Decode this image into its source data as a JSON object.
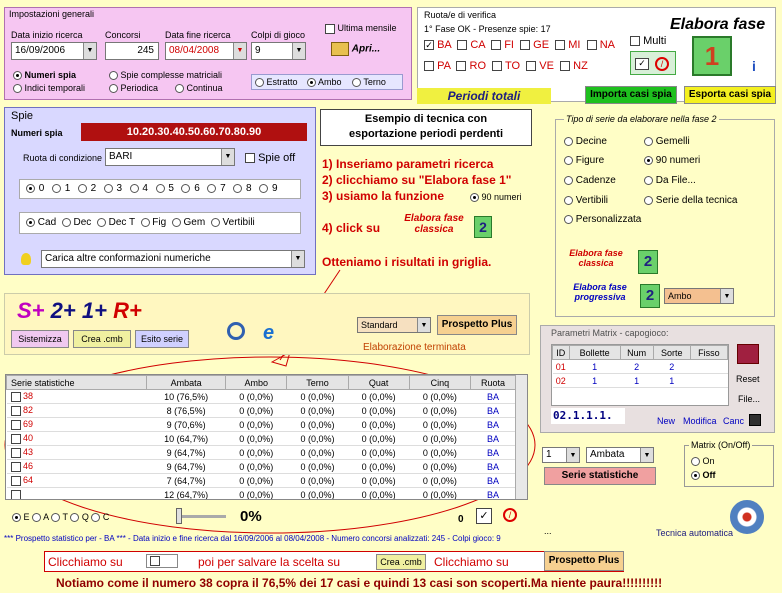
{
  "general": {
    "title": "Impostazioni generali",
    "concorsi_label": "Concorsi",
    "data_inizio_label": "Data inizio ricerca",
    "data_fine_label": "Data fine ricerca",
    "colpi_label": "Colpi di gioco",
    "data_inizio": "16/09/2006",
    "concorsi": "245",
    "data_fine": "08/04/2008",
    "colpi": "9",
    "ultima_mensile": "Ultima mensile",
    "apri": "Apri...",
    "opt_numeri_spia": "Numeri spia",
    "opt_indici": "Indici temporali",
    "opt_spie_complesse": "Spie complesse matriciali",
    "opt_periodica": "Periodica",
    "opt_continua": "Continua",
    "opt_estratto": "Estratto",
    "opt_ambo": "Ambo",
    "opt_terno": "Terno"
  },
  "ruota": {
    "title": "Ruota/e di verifica",
    "status": "1° Fase OK - Presenze spie: 17",
    "row1": [
      "BA",
      "CA",
      "FI",
      "GE",
      "MI",
      "NA"
    ],
    "row2": [
      "PA",
      "RO",
      "TO",
      "VE",
      "NZ"
    ],
    "multi": "Multi"
  },
  "elabora": {
    "title": "Elabora fase",
    "badge": "1"
  },
  "periodi_totali": "Periodi totali",
  "importa": "Importa casi spia",
  "esporta": "Esporta casi spia",
  "spie": {
    "title": "Spie",
    "numeri_label": "Numeri spia",
    "numeri_value": "10.20.30.40.50.60.70.80.90",
    "ruota_label": "Ruota di condizione",
    "ruota_value": "BARI",
    "spie_off": "Spie off",
    "digits": [
      "0",
      "1",
      "2",
      "3",
      "4",
      "5",
      "6",
      "7",
      "8",
      "9"
    ],
    "types": [
      "Cad",
      "Dec",
      "Dec T",
      "Fig",
      "Gem",
      "Vertibili"
    ],
    "carica": "Carica altre conformazioni numeriche"
  },
  "tutorial": {
    "title_line1": "Esempio di tecnica con",
    "title_line2": "esportazione periodi perdenti",
    "step1": "1) Inseriamo parametri ricerca",
    "step2": "2) clicchiamo su \"Elabora fase 1\"",
    "step3": "3) usiamo la funzione",
    "novanta": "90 numeri",
    "step4": "4) click su",
    "elabora_classica": "Elabora fase classica",
    "badge2": "2",
    "result": "Otteniamo i risultati in griglia."
  },
  "tipo": {
    "title": "Tipo di serie da elaborare nella fase 2",
    "left": [
      "Decine",
      "Figure",
      "Cadenze",
      "Vertibili",
      "Personalizzata"
    ],
    "right": [
      "Gemelli",
      "90 numeri",
      "Da File...",
      "Serie della tecnica"
    ],
    "classica": "Elabora fase classica",
    "progressiva": "Elabora fase progressiva",
    "badge": "2",
    "ambo": "Ambo"
  },
  "formula": {
    "s": "S+",
    "two": "2+",
    "one": "1+",
    "r": "R+",
    "sistemizza": "Sistemizza",
    "crea": "Crea .cmb",
    "esito": "Esito serie",
    "standard": "Standard",
    "prospetto": "Prospetto Plus",
    "terminata": "Elaborazione terminata"
  },
  "matrix": {
    "title": "Parametri Matrix - capogioco:",
    "headers": [
      "ID",
      "Bollette",
      "Num",
      "Sorte",
      "Fisso"
    ],
    "rows": [
      [
        "01",
        "1",
        "2",
        "2",
        ""
      ],
      [
        "02",
        "1",
        "1",
        "1",
        ""
      ]
    ],
    "code": "02.1.1.1.",
    "reset": "Reset",
    "file": "File...",
    "new": "New",
    "modifica": "Modifica",
    "canc": "Canc",
    "onoff_title": "Matrix (On/Off)",
    "on": "On",
    "off": "Off",
    "sel_num": "1",
    "sel_sorte": "Ambata",
    "serie_stat": "Serie statistiche",
    "tecnica": "Tecnica automatica",
    "dots": "..."
  },
  "table": {
    "headers": [
      "Serie statistiche",
      "Ambata",
      "Ambo",
      "Terno",
      "Quat",
      "Cinq",
      "Ruota"
    ],
    "rows": [
      [
        "38",
        "10 (76,5%)",
        "0 (0,0%)",
        "0 (0,0%)",
        "0 (0,0%)",
        "0 (0,0%)",
        "BA"
      ],
      [
        "82",
        "8 (76,5%)",
        "0 (0,0%)",
        "0 (0,0%)",
        "0 (0,0%)",
        "0 (0,0%)",
        "BA"
      ],
      [
        "69",
        "9 (70,6%)",
        "0 (0,0%)",
        "0 (0,0%)",
        "0 (0,0%)",
        "0 (0,0%)",
        "BA"
      ],
      [
        "40",
        "10 (64,7%)",
        "0 (0,0%)",
        "0 (0,0%)",
        "0 (0,0%)",
        "0 (0,0%)",
        "BA"
      ],
      [
        "43",
        "9 (64,7%)",
        "0 (0,0%)",
        "0 (0,0%)",
        "0 (0,0%)",
        "0 (0,0%)",
        "BA"
      ],
      [
        "46",
        "9 (64,7%)",
        "0 (0,0%)",
        "0 (0,0%)",
        "0 (0,0%)",
        "0 (0,0%)",
        "BA"
      ],
      [
        "64",
        "7 (64,7%)",
        "0 (0,0%)",
        "0 (0,0%)",
        "0 (0,0%)",
        "0 (0,0%)",
        "BA"
      ],
      [
        "",
        "12 (64,7%)",
        "0 (0,0%)",
        "0 (0,0%)",
        "0 (0,0%)",
        "0 (0,0%)",
        "BA"
      ]
    ],
    "bottom_opts": [
      "E",
      "A",
      "T",
      "Q",
      "C"
    ],
    "percent": "0%",
    "zero": "0"
  },
  "status_line": "*** Prospetto statistico per  - BA ***  - Data inizio e fine ricerca dal 16/09/2006 al 08/04/2008 - Numero concorsi analizzati: 245 - Colpi gioco: 9",
  "footer": {
    "clicchiamo1": "Clicchiamo su",
    "poi": "poi per salvare la scelta su",
    "crea": "Crea .cmb",
    "clicchiamo2": "Clicchiamo su",
    "prospetto": "Prospetto Plus",
    "note": "Notiamo come il numero 38 copra il 76,5% dei 17 casi e quindi 13 casi son scoperti.Ma niente paura!!!!!!!!!!"
  },
  "colors": {
    "pink": "#f6c6f2",
    "lavender": "#d9d8ff",
    "spia_bar": "#b01010",
    "green_btn": "#1ec01e",
    "yellow_btn": "#f4f020"
  }
}
